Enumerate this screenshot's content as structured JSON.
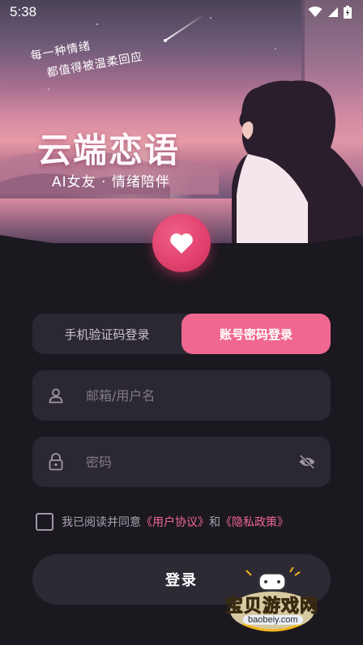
{
  "status_bar": {
    "time": "5:38"
  },
  "hero": {
    "slogan_line1": "每一种情绪",
    "slogan_line2": "都值得被温柔回应",
    "app_title": "云端恋语",
    "app_subtitle": "AI女友 · 情绪陪伴"
  },
  "tabs": [
    {
      "label": "手机验证码登录",
      "active": false
    },
    {
      "label": "账号密码登录",
      "active": true
    }
  ],
  "username": {
    "placeholder": "邮箱/用户名",
    "value": "",
    "icon": "user-icon"
  },
  "password": {
    "placeholder": "密码",
    "value": "",
    "icon": "lock-icon",
    "toggle_icon": "eye-off-icon"
  },
  "agreement": {
    "prefix": "我已阅读并同意",
    "user_agreement": "《用户协议》",
    "and": "和",
    "privacy_policy": "《隐私政策》",
    "checked": false
  },
  "login_button": {
    "label": "登录"
  },
  "watermark": {
    "text": "宝贝游戏网",
    "url": "baobeiy.com"
  },
  "colors": {
    "accent": "#f06890",
    "background": "#1b1820",
    "field": "#2c2833"
  }
}
